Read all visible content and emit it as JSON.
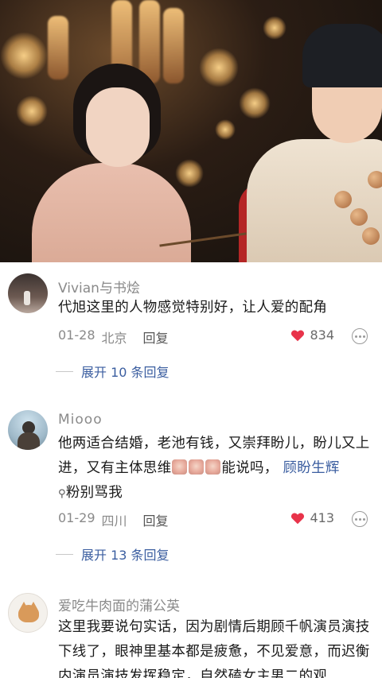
{
  "video": {
    "scene": "historical drama still"
  },
  "comments": [
    {
      "username": "Vivian与书烩",
      "text": "代旭这里的人物感觉特别好，让人爱的配角",
      "date": "01-28",
      "location": "北京",
      "reply_label": "回复",
      "likes": "834",
      "expand_label": "展开 10 条回复"
    },
    {
      "username": "Miooo",
      "text_part1": "他两适合结婚，老池有钱，又崇拜盼儿，盼儿又上进，又有主体思维",
      "text_part2": "能说吗，",
      "mention": "顾盼生辉",
      "text_part3": "粉别骂我",
      "date": "01-29",
      "location": "四川",
      "reply_label": "回复",
      "likes": "413",
      "expand_label": "展开 13 条回复"
    },
    {
      "username": "爱吃牛肉面的蒲公英",
      "text": "这里我要说句实话，因为剧情后期顾千帆演员演技下线了，眼神里基本都是疲惫，不见爱意，而迟衡内演员演技发挥稳定，自然磕女主男二的观"
    }
  ],
  "colors": {
    "like_heart": "#e8334a",
    "link": "#3b5ea0"
  },
  "icons": [
    "heart-icon",
    "more-options-icon",
    "search-icon",
    "emoji-icon"
  ]
}
